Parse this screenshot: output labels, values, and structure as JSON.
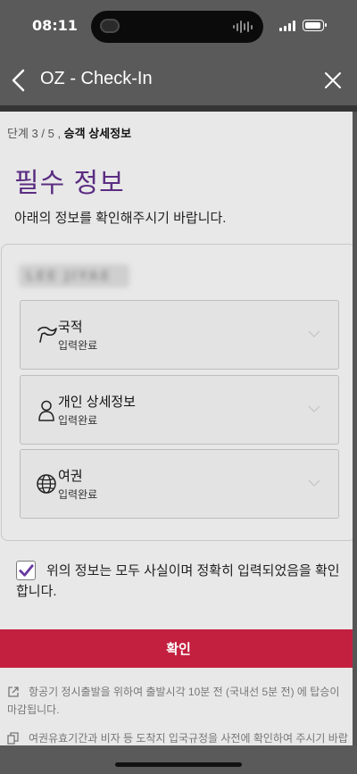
{
  "status_bar": {
    "time": "08:11"
  },
  "app_bar": {
    "title": "OZ - Check-In"
  },
  "step": {
    "prefix": "단계 3 / 5 , ",
    "current": "승객 상세정보"
  },
  "page": {
    "title": "필수 정보",
    "subtitle": "아래의 정보를 확인해주시기 바랍니다."
  },
  "passenger": {
    "name": "LEE JIYAE"
  },
  "sections": [
    {
      "label": "국적",
      "status": "입력완료",
      "icon": "flag-icon"
    },
    {
      "label": "개인 상세정보",
      "status": "입력완료",
      "icon": "person-icon"
    },
    {
      "label": "여권",
      "status": "입력완료",
      "icon": "globe-icon"
    }
  ],
  "agreement": {
    "checked": true,
    "text": "위의 정보는 모두 사실이며 정확히 입력되었음을 확인합니다."
  },
  "confirm_button": {
    "label": "확인"
  },
  "notes": [
    {
      "text": "항공기 정시출발을 위하여 출발시각 10분 전 (국내선 5분 전) 에 탑승이 마감됩니다.",
      "icon": "external-link-icon"
    },
    {
      "text": "여권유효기간과 비자 등 도착지 입국규정을 사전에 확인하여 주시기 바랍니다.",
      "icon": "document-icon"
    }
  ],
  "colors": {
    "accent_purple": "#5b2d82",
    "confirm_red": "#c3203f",
    "check_purple": "#6a3aa0"
  }
}
